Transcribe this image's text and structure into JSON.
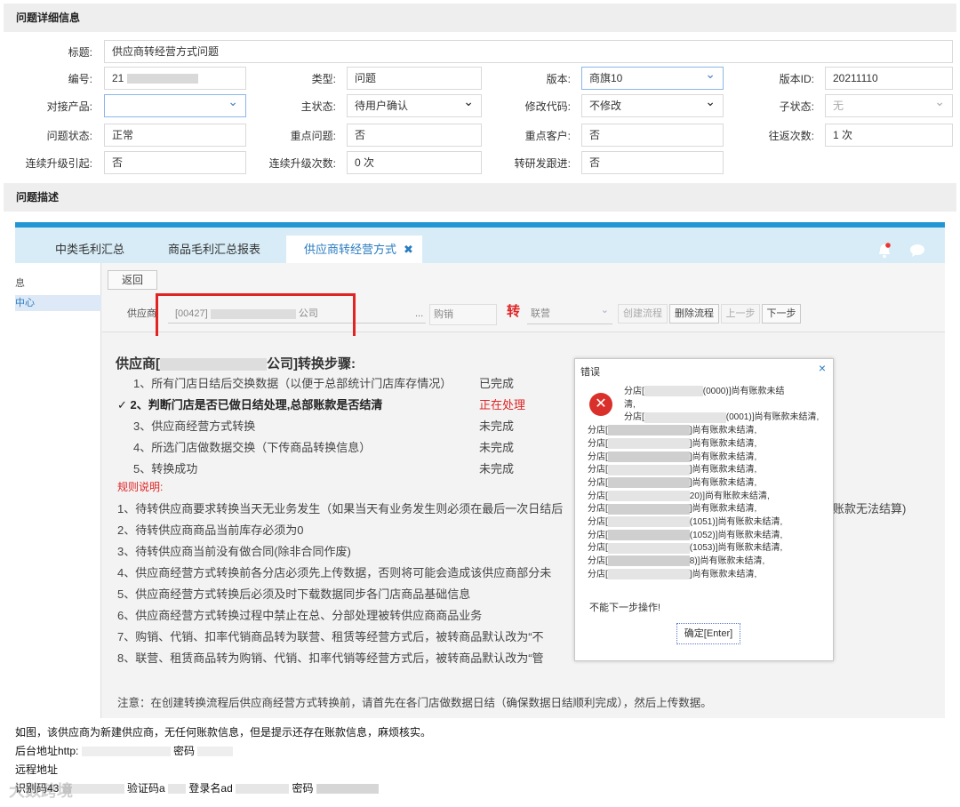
{
  "detail_section": {
    "title": "问题详细信息"
  },
  "fields": {
    "title": {
      "label": "标题:",
      "value": "供应商转经营方式问题"
    },
    "number": {
      "label": "编号:",
      "value": "21"
    },
    "type": {
      "label": "类型:",
      "value": "问题"
    },
    "version": {
      "label": "版本:",
      "value": "商旗10"
    },
    "version_id": {
      "label": "版本ID:",
      "value": "20211110"
    },
    "product": {
      "label": "对接产品:",
      "value": ""
    },
    "main_status": {
      "label": "主状态:",
      "value": "待用户确认"
    },
    "modify_code": {
      "label": "修改代码:",
      "value": "不修改"
    },
    "sub_status": {
      "label": "子状态:",
      "value": "无"
    },
    "issue_status": {
      "label": "问题状态:",
      "value": "正常"
    },
    "key_issue": {
      "label": "重点问题:",
      "value": "否"
    },
    "key_customer": {
      "label": "重点客户:",
      "value": "否"
    },
    "round_trips": {
      "label": "往返次数:",
      "value": "1 次"
    },
    "escalation": {
      "label": "连续升级引起:",
      "value": "否"
    },
    "escalation_count": {
      "label": "连续升级次数:",
      "value": "0 次"
    },
    "rd_follow": {
      "label": "转研发跟进:",
      "value": "否"
    }
  },
  "desc_section": {
    "title": "问题描述"
  },
  "screenshot": {
    "tabs": [
      {
        "label": "中类毛利汇总"
      },
      {
        "label": "商品毛利汇总报表"
      },
      {
        "label": "供应商转经营方式",
        "close": "✖"
      }
    ],
    "menu": {
      "item1": "息",
      "item2": "中心"
    },
    "toolbar": {
      "back": "返回",
      "supplier_label": "供应商",
      "supplier_code": "[00427]",
      "supplier_suffix": "公司",
      "ellipsis": "...",
      "purchase_mode": "购销",
      "convert_char": "转",
      "target_mode": "联营",
      "create_flow": "创建流程",
      "delete_flow": "删除流程",
      "prev": "上一步",
      "next": "下一步"
    },
    "steps_title_prefix": "供应商[",
    "steps_title_suffix": "公司]转换步骤:",
    "steps": [
      {
        "text": "1、所有门店日结后交换数据（以便于总部统计门店库存情况）",
        "status": "已完成"
      },
      {
        "text": "✓ 2、判断门店是否已做日结处理,总部账款是否结清",
        "status": "正在处理"
      },
      {
        "text": "3、供应商经营方式转换",
        "status": "未完成"
      },
      {
        "text": "4、所选门店做数据交换（下传商品转换信息）",
        "status": "未完成"
      },
      {
        "text": "5、转换成功",
        "status": "未完成"
      }
    ],
    "rules_title": "规则说明:",
    "rules": [
      "1、待转供应商要求转换当天无业务发生（如果当天有业务发生则必须在最后一次日结后",
      "2、待转供应商商品当前库存必须为0",
      "3、待转供应商当前没有做合同(除非合同作废)",
      "4、供应商经营方式转换前各分店必须先上传数据，否则将可能会造成该供应商部分未",
      "5、供应商经营方式转换后必须及时下载数据同步各门店商品基础信息",
      "6、供应商经营方式转换过程中禁止在总、分部处理被转供应商商品业务",
      "7、购销、代销、扣率代销商品转为联营、租赁等经营方式后，被转商品默认改为“不",
      "8、联营、租赁商品转为购销、代销、扣率代销等经营方式后，被转商品默认改为“管"
    ],
    "rule1_tail": "账款无法结算)",
    "note": "注意：在创建转换流程后供应商经营方式转换前，请首先在各门店做数据日结（确保数据日结顺利完成），然后上传数据。",
    "dialog": {
      "title": "错误",
      "close": "×",
      "lines": [
        "分店[",
        "清,",
        "分店[",
        "分店[",
        "分店[",
        "分店[",
        "分店[",
        "分店[",
        "分店[",
        "分店[",
        "分店[",
        "分店[",
        "分店[",
        "分店[",
        "分店["
      ],
      "tails": [
        "(0000)]尚有账款未结",
        "",
        "(0001)]尚有账款未结清,",
        "]尚有账款未结清,",
        "]尚有账款未结清,",
        "]尚有账款未结清,",
        "]尚有账款未结清,",
        "]尚有账款未结清,",
        "20)]尚有账款未结清,",
        "]尚有账款未结清,",
        "(1051)]尚有账款未结清,",
        "(1052)]尚有账款未结清,",
        "(1053)]尚有账款未结清,",
        "8)]尚有账款未结清,",
        "]尚有账款未结清,"
      ],
      "footer": "不能下一步操作!",
      "ok": "确定[Enter]"
    }
  },
  "notes": {
    "line1": "如图，该供应商为新建供应商，无任何账款信息，但是提示还存在账款信息，麻烦核实。",
    "line2_prefix": "后台地址http:",
    "line2_pwd": "密码",
    "line3": "远程地址",
    "line4_id": "识别码43",
    "line4_code": "验证码a",
    "line4_login": "登录名ad",
    "line4_pwd": "密码"
  },
  "watermark": "大数跨境",
  "colors": {
    "accent": "#2196d3",
    "error": "#e02424",
    "section_bg": "#eeeeee"
  }
}
